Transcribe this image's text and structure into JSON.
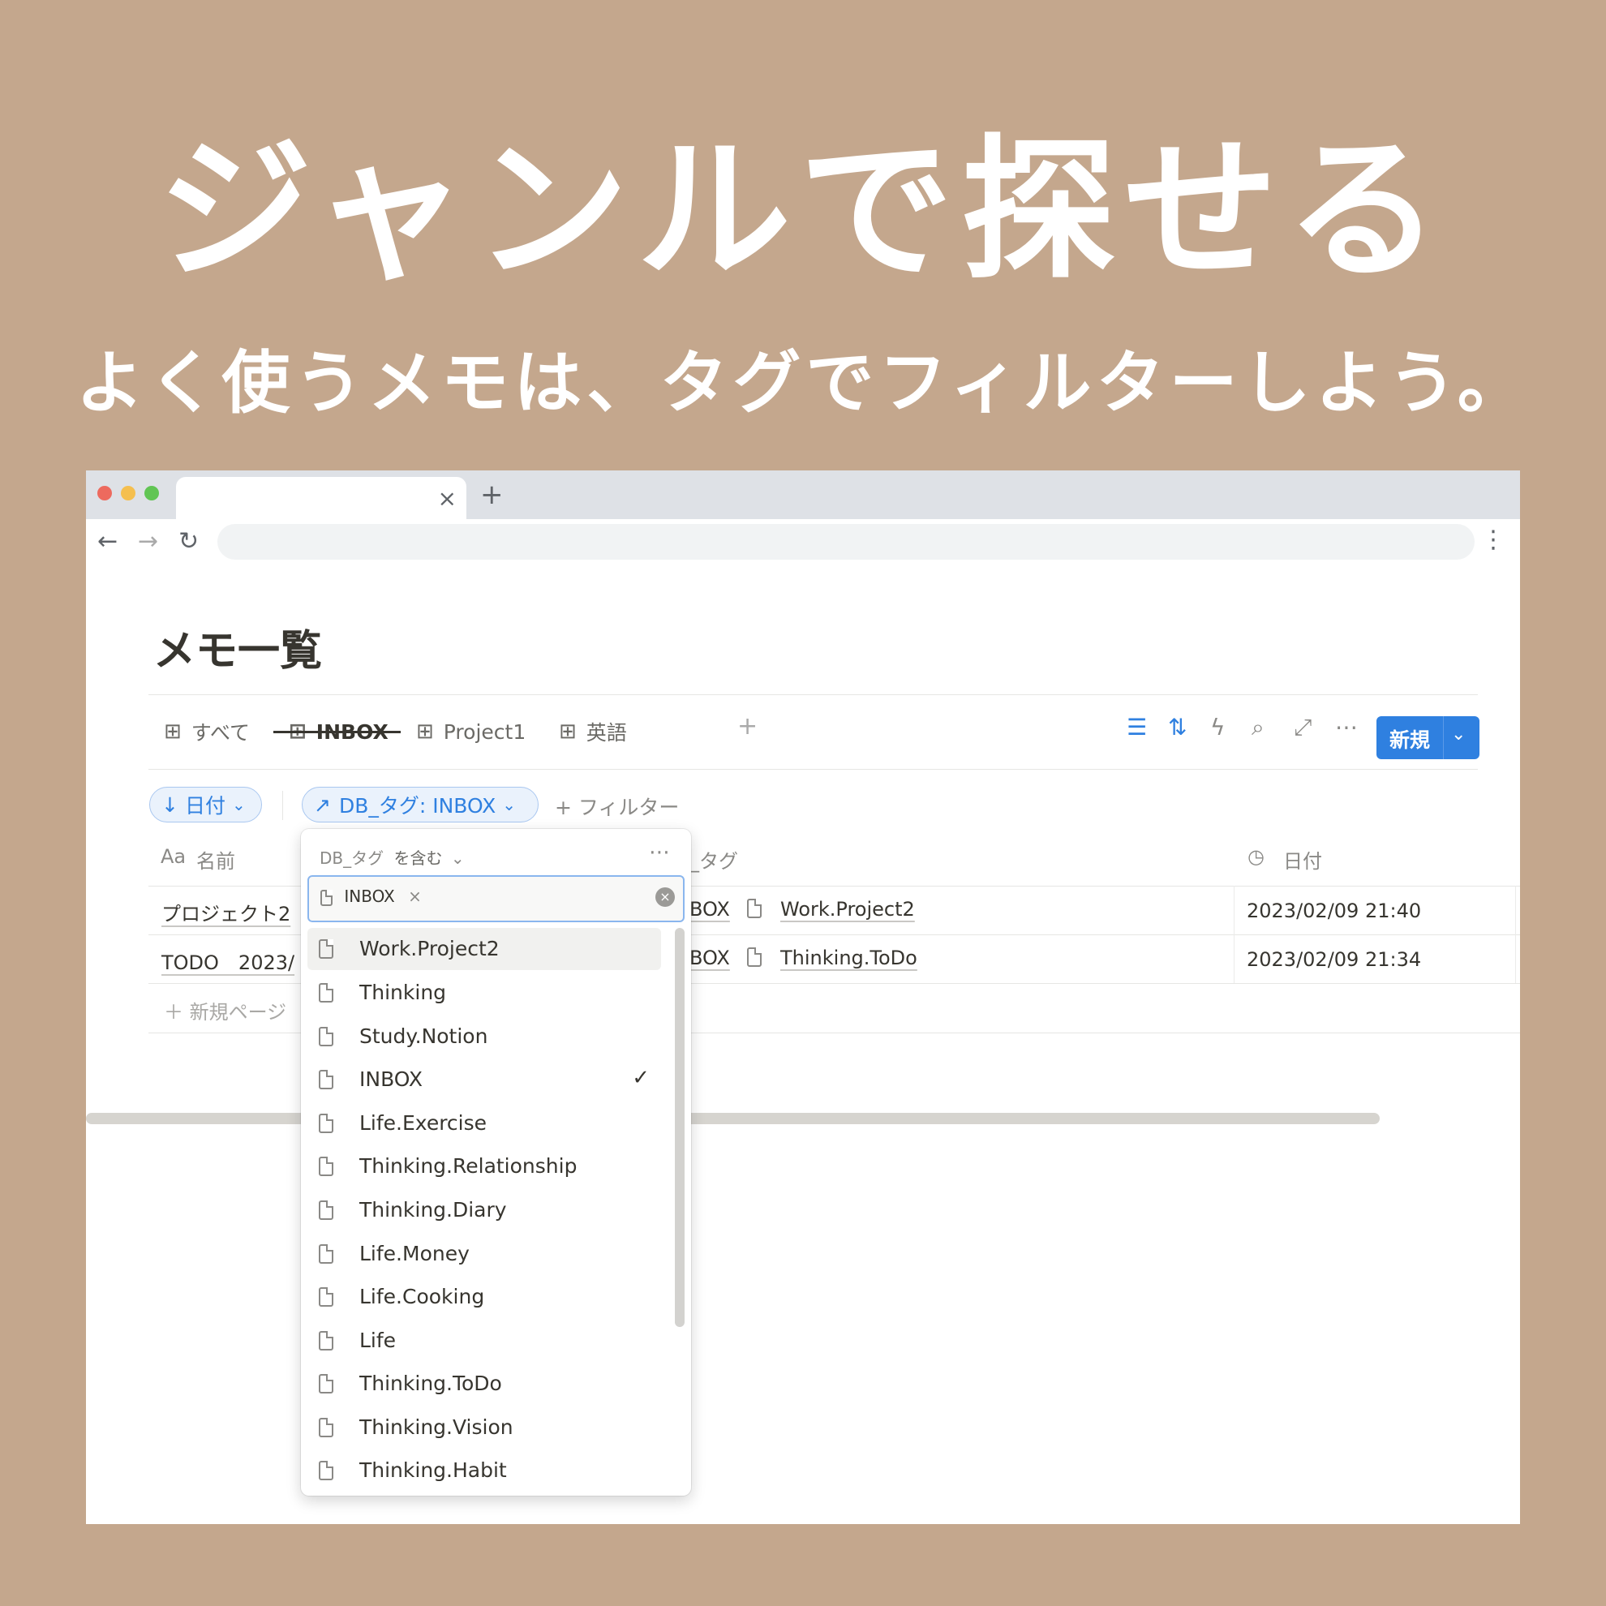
{
  "headline": "ジャンルで探せる",
  "subheadline": "よく使うメモは、タグでフィルターしよう。",
  "browser": {
    "tab_close": "×",
    "new_tab": "+",
    "nav_back": "←",
    "nav_forward": "→",
    "nav_reload": "↻",
    "menu": "⋮"
  },
  "page": {
    "title": "メモ一覧",
    "views": [
      {
        "label": "すべて"
      },
      {
        "label": "INBOX"
      },
      {
        "label": "Project1"
      },
      {
        "label": "英語"
      }
    ],
    "add_view": "+",
    "new_button": "新規"
  },
  "filters": {
    "sort_chip": "日付",
    "tag_chip": "DB_タグ: INBOX",
    "add_filter": "+ フィルター"
  },
  "table": {
    "columns": {
      "name_prefix": "Aa",
      "name": "名前",
      "tag": "_タグ",
      "date": "日付"
    },
    "rows": [
      {
        "name": "プロジェクト2",
        "tag_cut": "BOX",
        "tag": "Work.Project2",
        "date": "2023/02/09 21:40"
      },
      {
        "name": "TODO　2023/",
        "tag_cut": "BOX",
        "tag": "Thinking.ToDo",
        "date": "2023/02/09 21:34"
      }
    ],
    "new_page": "＋ 新規ページ"
  },
  "dropdown": {
    "header_property": "DB_タグ",
    "header_condition": "を含む",
    "selected_token": "INBOX",
    "options": [
      {
        "label": "Work.Project2",
        "check": ""
      },
      {
        "label": "Thinking",
        "check": ""
      },
      {
        "label": "Study.Notion",
        "check": ""
      },
      {
        "label": "INBOX",
        "check": "✓"
      },
      {
        "label": "Life.Exercise",
        "check": ""
      },
      {
        "label": "Thinking.Relationship",
        "check": ""
      },
      {
        "label": "Thinking.Diary",
        "check": ""
      },
      {
        "label": "Life.Money",
        "check": ""
      },
      {
        "label": "Life.Cooking",
        "check": ""
      },
      {
        "label": "Life",
        "check": ""
      },
      {
        "label": "Thinking.ToDo",
        "check": ""
      },
      {
        "label": "Thinking.Vision",
        "check": ""
      },
      {
        "label": "Thinking.Habit",
        "check": ""
      }
    ]
  },
  "colors": {
    "background": "#c4a78d",
    "accent": "#2f80e0",
    "text": "#37352f"
  }
}
